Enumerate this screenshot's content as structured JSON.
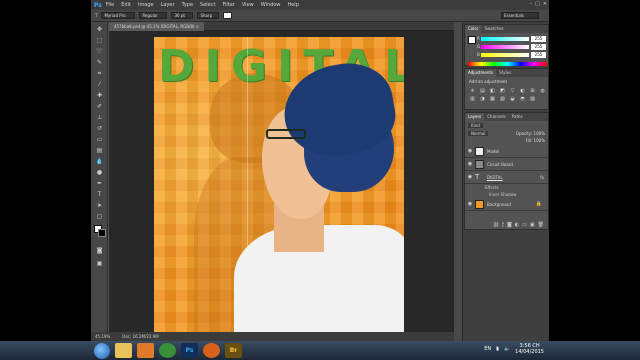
{
  "menubar": {
    "logo": "Ps",
    "items": [
      "File",
      "Edit",
      "Image",
      "Layer",
      "Type",
      "Select",
      "Filter",
      "View",
      "Window",
      "Help"
    ],
    "window_controls": [
      "–",
      "□",
      "✕"
    ]
  },
  "options_bar": {
    "tool_icon": "T",
    "font_family": "Myriad Pro",
    "font_style": "Regular",
    "font_size": "36 pt",
    "anti_alias": "Sharp",
    "workspace": "Essentials"
  },
  "document_tab": {
    "title": "457bba8.psd @ 45.1% (DIGITAL, RGB/8) ×"
  },
  "canvas": {
    "headline": "DIGITAL"
  },
  "status_bar": {
    "zoom": "45.19%",
    "doc_info": "Doc: 16.2M/22.9M"
  },
  "color_panel": {
    "tabs": [
      "Color",
      "Swatches"
    ],
    "channels": [
      {
        "name": "R",
        "value": "255",
        "color": "#ff4040"
      },
      {
        "name": "G",
        "value": "255",
        "color": "#40c040"
      },
      {
        "name": "B",
        "value": "255",
        "color": "#4080ff"
      }
    ]
  },
  "adjustments_panel": {
    "tabs": [
      "Adjustments",
      "Styles"
    ],
    "heading": "Add an adjustment",
    "icons": [
      "☀",
      "▤",
      "◧",
      "◩",
      "▽",
      "◐",
      "⊞",
      "◍",
      "▥",
      "◑",
      "▦",
      "▧",
      "◒",
      "◓",
      "▨"
    ]
  },
  "layers_panel": {
    "tabs": [
      "Layers",
      "Channels",
      "Paths"
    ],
    "kind_filter": "Kind",
    "blend_mode": "Normal",
    "opacity": "Opacity: 100%",
    "fill": "Fill: 100%",
    "layers": [
      {
        "name": "Model",
        "thumb_color": "#eeeeee",
        "selected": false
      },
      {
        "name": "Circuit Board",
        "thumb_color": "#8a8a8a",
        "selected": false
      },
      {
        "name": "DIGITAL",
        "thumb_color": "#555555",
        "selected": false,
        "fx": "fx"
      },
      {
        "name": "Background",
        "thumb_color": "#f39a25",
        "selected": false
      }
    ],
    "effects_label": "Effects",
    "inner_shadow_label": "Inner Shadow"
  },
  "taskbar": {
    "apps": [
      {
        "name": "file-explorer",
        "label": "",
        "color": "#e8c35a"
      },
      {
        "name": "media-player",
        "label": "",
        "color": "#e07a2a"
      },
      {
        "name": "chrome",
        "label": "",
        "color": "#3a8f3a"
      },
      {
        "name": "photoshop",
        "label": "Ps",
        "color": "#0f2f5a"
      },
      {
        "name": "wmp",
        "label": "",
        "color": "#d9601c"
      },
      {
        "name": "bridge",
        "label": "Br",
        "color": "#6b4e12"
      }
    ],
    "language": "EN",
    "time": "3:56 CH",
    "date": "14/04/2015"
  }
}
